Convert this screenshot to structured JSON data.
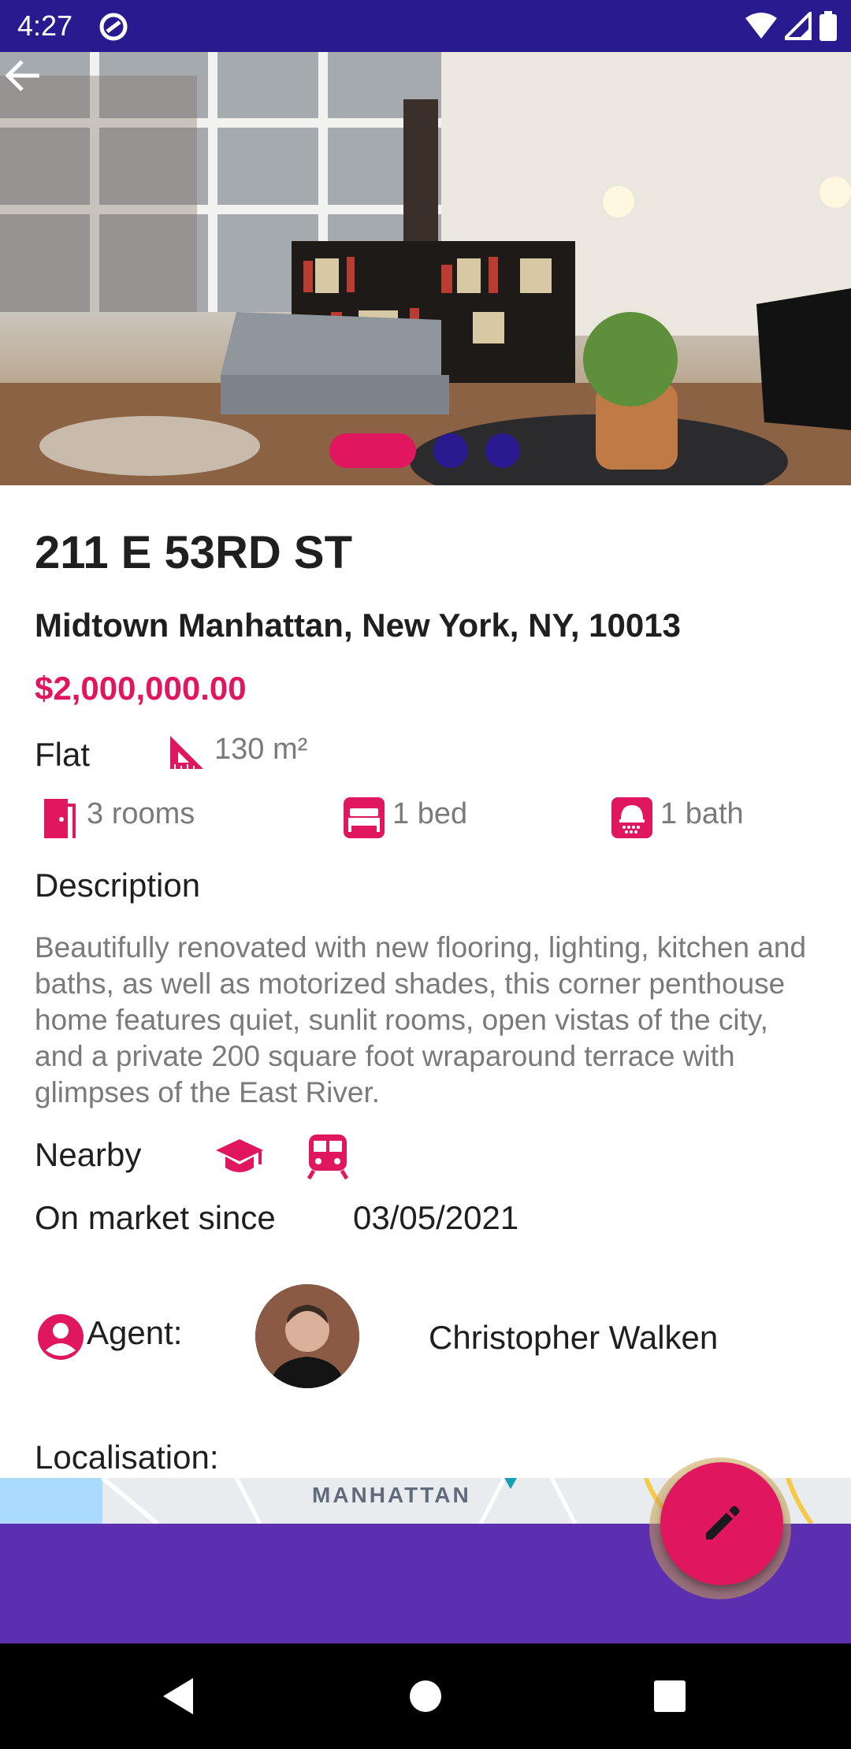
{
  "status_bar": {
    "time": "4:27"
  },
  "listing": {
    "title": "211 E 53RD ST",
    "address": "Midtown Manhattan, New York, NY, 10013",
    "price": "$2,000,000.00",
    "type": "Flat",
    "area": "130 m²",
    "rooms": "3 rooms",
    "beds": "1 bed",
    "baths": "1 bath",
    "description_label": "Description",
    "description": "Beautifully renovated with new flooring, lighting, kitchen and baths, as well as motorized shades, this corner penthouse home features quiet, sunlit rooms, open vistas of the city, and a private 200 square foot wraparound terrace with glimpses of the East River.",
    "nearby_label": "Nearby",
    "nearby_icons": [
      "school-icon",
      "train-icon"
    ],
    "market_label": "On market since",
    "market_date": "03/05/2021",
    "agent_label": "Agent:",
    "agent_name": "Christopher Walken",
    "localisation_label": "Localisation:",
    "map_label": "MANHATTAN"
  },
  "carousel": {
    "page_count": 3,
    "active_index": 0
  },
  "colors": {
    "accent": "#e0175f",
    "primary_dark": "#2a1a8f",
    "bottom_bar": "#5b2fb0"
  }
}
